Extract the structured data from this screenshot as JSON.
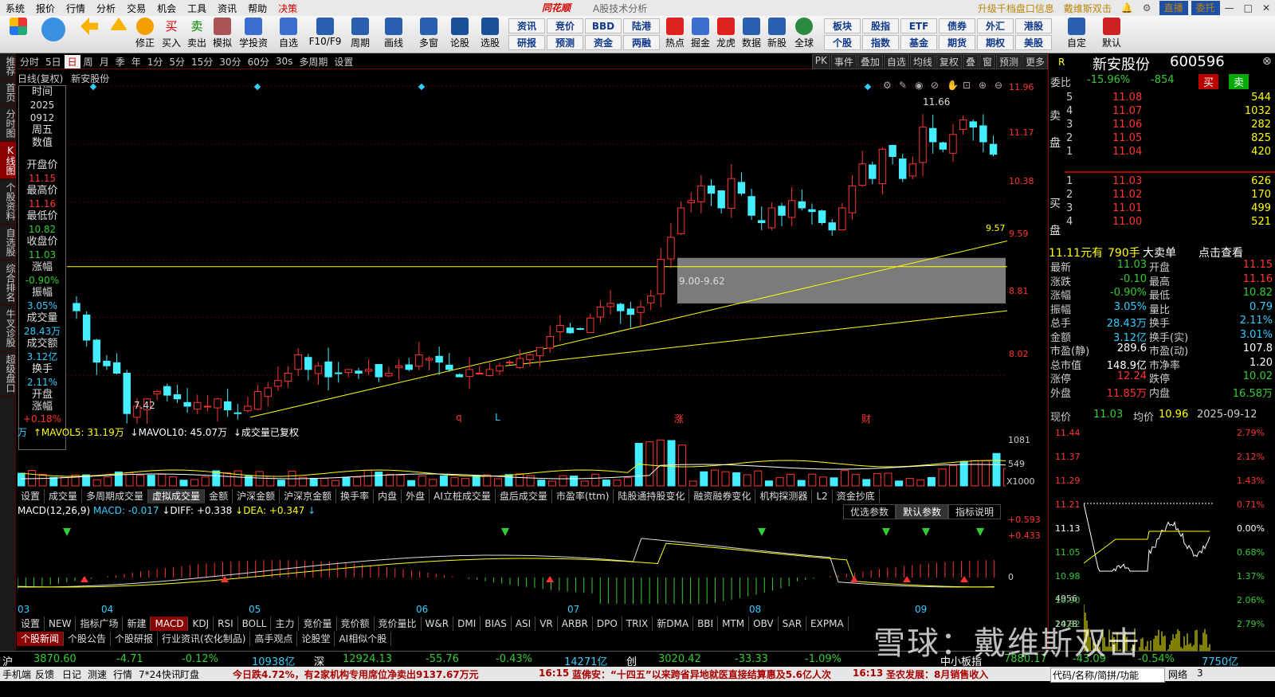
{
  "menu": {
    "items": [
      "系统",
      "报价",
      "行情",
      "分析",
      "交易",
      "机会",
      "工具",
      "资讯",
      "帮助",
      "决策"
    ],
    "brand": "同花顺",
    "subtitle": "A股技术分析",
    "right": [
      "升级千档盘口信息",
      "戴维斯双击"
    ],
    "buttons": [
      "直播",
      "委托"
    ]
  },
  "toolbar": {
    "buttons": [
      "修正",
      "买入",
      "卖出",
      "模拟",
      "学投资",
      "自选",
      "F10/F9",
      "周期",
      "画线",
      "多窗",
      "论股",
      "选股",
      "热点",
      "掘金",
      "龙虎",
      "数据",
      "新股",
      "全球",
      "自定",
      "默认"
    ],
    "grid": [
      "资讯",
      "竞价",
      "BBD",
      "陆港",
      "板块",
      "股指",
      "ETF",
      "债券",
      "外汇",
      "港股",
      "研报",
      "预测",
      "资金",
      "两融",
      "个股",
      "指数",
      "基金",
      "期货",
      "期权",
      "美股"
    ]
  },
  "leftnav": [
    "推荐",
    "首页",
    "分时图",
    "K线图",
    "个股资料",
    "自选股",
    "综合排名",
    "牛叉诊股",
    "超级盘口"
  ],
  "periods": [
    "分时",
    "5日",
    "日",
    "周",
    "月",
    "季",
    "年",
    "1分",
    "5分",
    "15分",
    "30分",
    "60分",
    "30s",
    "多周期",
    "设置"
  ],
  "period_active": "日",
  "period_right": [
    "PK",
    "事件",
    "叠加",
    "自选",
    "均线",
    "复权",
    "叠",
    "窗",
    "预测",
    "更多"
  ],
  "chart_info": {
    "type": "日线(复权)",
    "stock": "新安股份"
  },
  "info": {
    "time_label": "时间",
    "year": "2025",
    "date": "0912",
    "weekday": "周五",
    "value_label": "数值",
    "open_label": "开盘价",
    "open": "11.15",
    "high_label": "最高价",
    "high": "11.16",
    "low_label": "最低价",
    "low": "10.82",
    "close_label": "收盘价",
    "close": "11.03",
    "chg_label": "涨幅",
    "chg": "-0.90%",
    "amp_label": "振幅",
    "amp": "3.05%",
    "vol_label": "成交量",
    "vol": "28.43万",
    "amt_label": "成交额",
    "amt": "3.12亿",
    "turn_label": "换手",
    "turn": "2.11%",
    "open_chg_label": "开盘涨幅",
    "open_chg": "+0.18%"
  },
  "price_axis": [
    "11.96",
    "11.17",
    "10.38",
    "9.59",
    "8.81",
    "8.02"
  ],
  "annot": {
    "high": "11.66",
    "low": "7.42",
    "zone": "9.00-9.62",
    "zone_right": "9.57",
    "marks": [
      "q",
      "L",
      "涨",
      "财"
    ]
  },
  "volume": {
    "unit": "万",
    "mavol5_label": "MAVOL5:",
    "mavol5": "31.19万",
    "mavol10_label": "MAVOL10:",
    "mavol10": "45.07万",
    "note": "成交量已复权",
    "axis": [
      "1081",
      "549",
      "X1000"
    ]
  },
  "tabs1": [
    "设置",
    "成交量",
    "多周期成交量",
    "虚拟成交量",
    "金额",
    "沪深金额",
    "沪深京金额",
    "换手率",
    "内盘",
    "外盘",
    "AI立桩成交量",
    "盘后成交量",
    "市盈率(ttm)",
    "陆股通持股变化",
    "融资融券变化",
    "机构探测器",
    "L2",
    "资金抄底"
  ],
  "macd": {
    "label": "MACD(12,26,9)",
    "macd": "MACD: -0.017",
    "diff": "DIFF: +0.338",
    "dea": "DEA: +0.347",
    "axis": [
      "+0.593",
      "+0.433",
      "0"
    ],
    "btns": [
      "优选参数",
      "默认参数",
      "指标说明"
    ]
  },
  "months": [
    "03",
    "04",
    "05",
    "06",
    "07",
    "08",
    "09"
  ],
  "tabs2": [
    "设置",
    "NEW",
    "指标广场",
    "新建",
    "MACD",
    "KDJ",
    "RSI",
    "BOLL",
    "主力",
    "竞价量",
    "竞价额",
    "竞价量比",
    "W&R",
    "DMI",
    "BIAS",
    "ASI",
    "VR",
    "ARBR",
    "DPO",
    "TRIX",
    "新DMA",
    "BBI",
    "MTM",
    "OBV",
    "SAR",
    "EXPMA"
  ],
  "tabs3": [
    "个股新闻",
    "个股公告",
    "个股研报",
    "行业资讯(农化制品)",
    "高手观点",
    "论股堂",
    "AI相似个股"
  ],
  "quote": {
    "flag": "R",
    "name": "新安股份",
    "code": "600596",
    "wb_label": "委比",
    "wb": "-15.96%",
    "wc": "-854",
    "buy": "买",
    "sell": "卖",
    "sell_label": "卖盘",
    "buy_label": "买盘",
    "asks": [
      [
        "5",
        "11.08",
        "544"
      ],
      [
        "4",
        "11.07",
        "1032"
      ],
      [
        "3",
        "11.06",
        "282"
      ],
      [
        "2",
        "11.05",
        "825"
      ],
      [
        "1",
        "11.04",
        "420"
      ]
    ],
    "bids": [
      [
        "1",
        "11.03",
        "626"
      ],
      [
        "2",
        "11.02",
        "170"
      ],
      [
        "3",
        "11.01",
        "499"
      ],
      [
        "4",
        "11.00",
        "521"
      ]
    ],
    "bigorder": {
      "price": "11.11元有",
      "qty": "790手",
      "label": "大卖单",
      "link": "点击查看"
    },
    "stats": [
      [
        "最新",
        "11.03",
        "开盘",
        "11.15"
      ],
      [
        "涨跌",
        "-0.10",
        "最高",
        "11.16"
      ],
      [
        "涨幅",
        "-0.90%",
        "最低",
        "10.82"
      ],
      [
        "振幅",
        "3.05%",
        "量比",
        "0.79"
      ],
      [
        "总手",
        "28.43万",
        "换手",
        "2.11%"
      ],
      [
        "金额",
        "3.12亿",
        "换手(实)",
        "3.01%"
      ],
      [
        "市盈(静)",
        "289.6",
        "市盈(动)",
        "107.8"
      ],
      [
        "总市值",
        "148.9亿",
        "市净率",
        "1.20"
      ],
      [
        "涨停",
        "12.24",
        "跌停",
        "10.02"
      ],
      [
        "外盘",
        "11.85万",
        "内盘",
        "16.58万"
      ]
    ],
    "now_label": "现价",
    "now": "11.03",
    "avg_label": "均价",
    "avg": "10.96",
    "date": "2025-09-12",
    "intraday_axis_left": [
      "11.44",
      "11.37",
      "11.29",
      "11.21",
      "11.13",
      "11.05",
      "10.98",
      "10.90",
      "10.82"
    ],
    "intraday_axis_right": [
      "2.79%",
      "2.12%",
      "1.43%",
      "0.71%",
      "0.00%",
      "0.68%",
      "1.37%",
      "2.06%",
      "2.79%"
    ],
    "intraday_vol": [
      "4956",
      "2478"
    ]
  },
  "status": {
    "sh_label": "沪",
    "sh": "3870.60",
    "sh_chg": "-4.71",
    "sh_pct": "-0.12%",
    "sh_amt": "10938亿",
    "sz_label": "深",
    "sz": "12924.13",
    "sz_chg": "-55.76",
    "sz_pct": "-0.43%",
    "sz_amt": "14271亿",
    "cy_label": "创",
    "cy": "3020.42",
    "cy_chg": "-33.33",
    "cy_pct": "-1.09%",
    "zx_label": "中小板指",
    "zx": "7880.17",
    "zx_chg": "-43.09",
    "zx_pct": "-0.54%",
    "zx_amt": "7750亿"
  },
  "bottom": {
    "items": [
      "手机端",
      "反馈",
      "日记",
      "测速",
      "行情",
      "7*24快讯",
      "盯盘"
    ],
    "news1": "今日跌4.72%，有2家机构专用席位净卖出9137.67万元",
    "news2_time": "16:15",
    "news2": "蓝佛安：“十四五”以来跨省异地就医直接结算惠及5.6亿人次",
    "news3_time": "16:13",
    "news3": "圣农发展：8月销售收入",
    "right": "代码/名称/简拼/功能",
    "net": "网络",
    "netval": "3"
  },
  "watermark": "雪球：戴维斯双击"
}
